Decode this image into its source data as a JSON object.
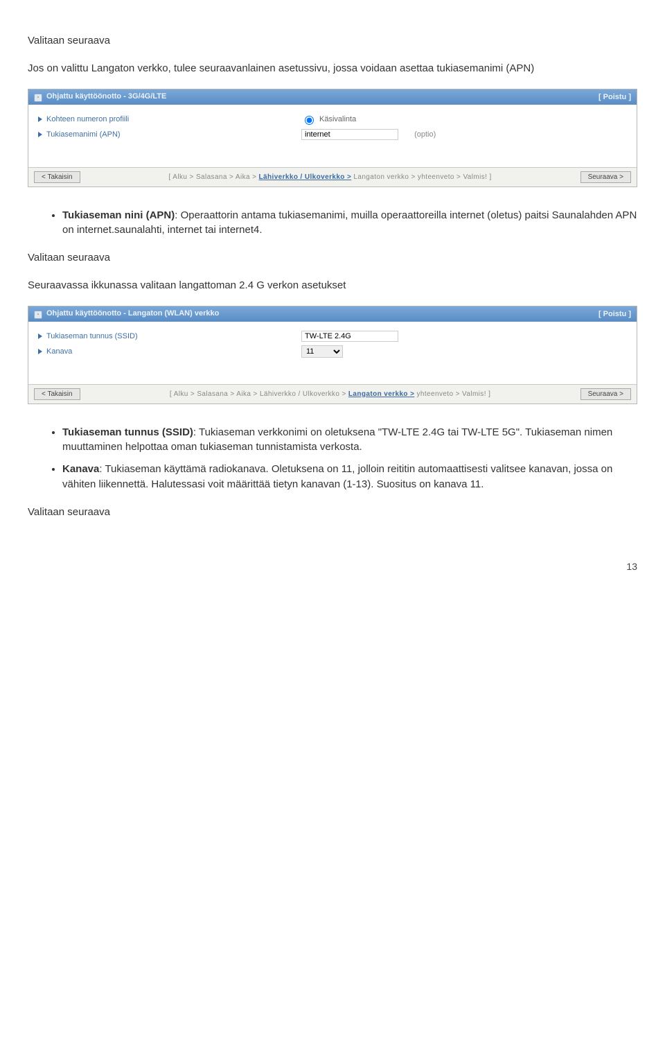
{
  "intro1": "Valitaan seuraava",
  "intro2": "Jos on valittu Langaton verkko, tulee seuraavanlainen asetussivu, jossa voidaan asettaa tukiasemanimi (APN)",
  "panel1": {
    "title": "Ohjattu käyttöönotto - 3G/4G/LTE",
    "exit": "[ Poistu ]",
    "item1": "Kohteen numeron profiili",
    "item2": "Tukiasemanimi (APN)",
    "radio_label": "Käsivalinta",
    "apn_value": "internet",
    "optio": "(optio)",
    "back": "< Takaisin",
    "next": "Seuraava >",
    "bc": {
      "p1": "[ Alku > Salasana > Aika > ",
      "cur": "Lähiverkko / Ulkoverkko >",
      "p2": " Langaton verkko > yhteenveto > Valmis! ]"
    }
  },
  "list1": {
    "i1_b": "Tukiaseman nini (APN)",
    "i1_t": ": Operaattorin antama tukiasemanimi, muilla operaattoreilla internet (oletus) paitsi Saunalahden APN on internet.saunalahti, internet tai internet4."
  },
  "mid1": "Valitaan seuraava",
  "mid2": "Seuraavassa ikkunassa valitaan langattoman 2.4 G verkon asetukset",
  "panel2": {
    "title": "Ohjattu käyttöönotto - Langaton (WLAN) verkko",
    "exit": "[ Poistu ]",
    "item1": "Tukiaseman tunnus (SSID)",
    "item2": "Kanava",
    "ssid_value": "TW-LTE 2.4G",
    "channel_value": "11",
    "back": "< Takaisin",
    "next": "Seuraava >",
    "bc": {
      "p1": "[ Alku > Salasana > Aika > Lähiverkko / Ulkoverkko > ",
      "cur": "Langaton verkko >",
      "p2": " yhteenveto > Valmis! ]"
    }
  },
  "list2": {
    "i1_b": "Tukiaseman tunnus (SSID)",
    "i1_t": ": Tukiaseman verkkonimi on oletuksena \"TW-LTE 2.4G tai TW-LTE 5G\". Tukiaseman nimen muuttaminen helpottaa oman tukiaseman tunnistamista verkosta.",
    "i2_b": "Kanava",
    "i2_t": ": Tukiaseman käyttämä radiokanava. Oletuksena on 11, jolloin reititin automaattisesti valitsee kanavan, jossa on vähiten liikennettä. Halutessasi voit määrittää tietyn kanavan (1-13). Suositus on kanava 11."
  },
  "end": "Valitaan seuraava",
  "pagenum": "13"
}
